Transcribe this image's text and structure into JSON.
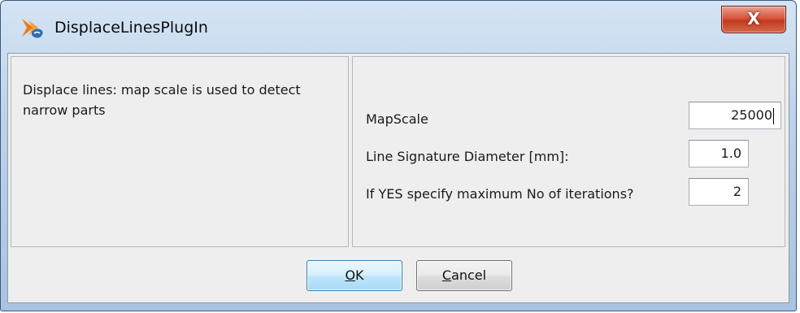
{
  "window": {
    "title": "DisplaceLinesPlugIn",
    "close_label": "X",
    "app_icon": "plugin-arrow-icon"
  },
  "description": "Displace lines: map scale is used to detect narrow parts",
  "fields": [
    {
      "label": "MapScale",
      "value": "25000"
    },
    {
      "label": "Line Signature Diameter [mm]:",
      "value": "1.0"
    },
    {
      "label": "If YES specify maximum No of iterations?",
      "value": "2"
    }
  ],
  "buttons": {
    "ok": {
      "mnemonic": "O",
      "rest": "K"
    },
    "cancel": {
      "mnemonic": "C",
      "rest": "ancel"
    }
  },
  "colors": {
    "close_button": "#c23a20",
    "ok_button_border": "#3c7fb1",
    "client_bg": "#eeeeee"
  }
}
